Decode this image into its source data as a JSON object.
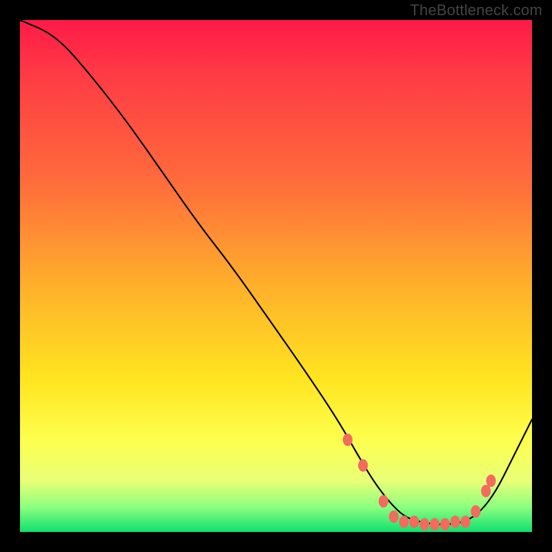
{
  "watermark": "TheBottleneck.com",
  "chart_data": {
    "type": "line",
    "title": "",
    "xlabel": "",
    "ylabel": "",
    "xlim": [
      0,
      100
    ],
    "ylim": [
      0,
      100
    ],
    "grid": false,
    "legend": false,
    "series": [
      {
        "name": "curve",
        "x": [
          0,
          7,
          14,
          21,
          28,
          35,
          42,
          49,
          56,
          62,
          66,
          69,
          72,
          75,
          78,
          81,
          84,
          87,
          90,
          93,
          96,
          100
        ],
        "y": [
          100,
          97,
          89,
          80,
          70,
          60,
          51,
          41,
          31,
          22,
          15,
          10,
          6,
          3,
          2,
          1.5,
          1.5,
          2,
          4,
          8,
          14,
          22
        ],
        "color": "#000000"
      }
    ],
    "markers": [
      {
        "x": 64,
        "y": 18,
        "color": "#f26b5e"
      },
      {
        "x": 67,
        "y": 13,
        "color": "#f26b5e"
      },
      {
        "x": 71,
        "y": 6,
        "color": "#f26b5e"
      },
      {
        "x": 73,
        "y": 3,
        "color": "#f26b5e"
      },
      {
        "x": 75,
        "y": 2,
        "color": "#f26b5e"
      },
      {
        "x": 77,
        "y": 2,
        "color": "#f26b5e"
      },
      {
        "x": 79,
        "y": 1.5,
        "color": "#f26b5e"
      },
      {
        "x": 81,
        "y": 1.5,
        "color": "#f26b5e"
      },
      {
        "x": 83,
        "y": 1.5,
        "color": "#f26b5e"
      },
      {
        "x": 85,
        "y": 2,
        "color": "#f26b5e"
      },
      {
        "x": 87,
        "y": 2,
        "color": "#f26b5e"
      },
      {
        "x": 89,
        "y": 4,
        "color": "#f26b5e"
      },
      {
        "x": 91,
        "y": 8,
        "color": "#f26b5e"
      },
      {
        "x": 92,
        "y": 10,
        "color": "#f26b5e"
      }
    ],
    "background_gradient_stops": [
      {
        "pos": 0.0,
        "color": "#ff1a48"
      },
      {
        "pos": 0.1,
        "color": "#ff3945"
      },
      {
        "pos": 0.32,
        "color": "#ff6d3b"
      },
      {
        "pos": 0.52,
        "color": "#ffb02b"
      },
      {
        "pos": 0.7,
        "color": "#ffe41f"
      },
      {
        "pos": 0.82,
        "color": "#fdff4d"
      },
      {
        "pos": 0.9,
        "color": "#eaff77"
      },
      {
        "pos": 0.95,
        "color": "#8fff7e"
      },
      {
        "pos": 1.0,
        "color": "#10e070"
      }
    ]
  }
}
